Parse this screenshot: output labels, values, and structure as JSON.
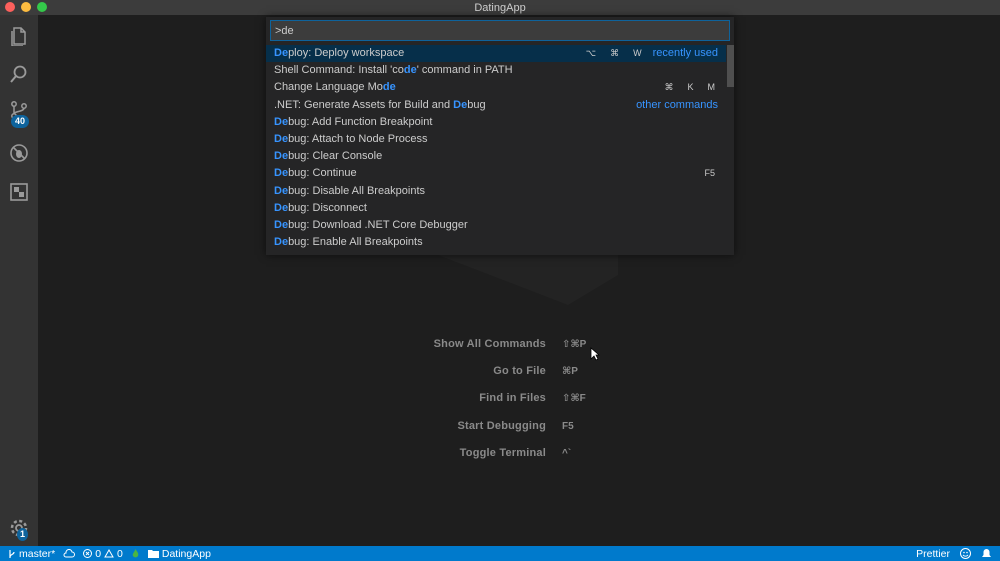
{
  "window": {
    "title": "DatingApp"
  },
  "activity": {
    "scm_badge": "40",
    "settings_badge": "1"
  },
  "palette": {
    "query": ">de",
    "items": [
      {
        "pre": "",
        "hl": "De",
        "post": "ploy: Deploy workspace",
        "keys": [
          "⌥",
          "⌘",
          "W"
        ],
        "tag": "recently used",
        "selected": true
      },
      {
        "pre": "Shell Command: Install 'co",
        "hl": "de",
        "post": "' command in PATH",
        "keys": [],
        "tag": ""
      },
      {
        "pre": "Change Language Mo",
        "hl": "de",
        "post": "",
        "keys": [
          "⌘",
          "K",
          "M"
        ],
        "tag": ""
      },
      {
        "pre": ".NET: Generate Assets for Build and ",
        "hl": "De",
        "post": "bug",
        "keys": [],
        "tag": "other commands"
      },
      {
        "pre": "",
        "hl": "De",
        "post": "bug: Add Function Breakpoint",
        "keys": [],
        "tag": ""
      },
      {
        "pre": "",
        "hl": "De",
        "post": "bug: Attach to Node Process",
        "keys": [],
        "tag": ""
      },
      {
        "pre": "",
        "hl": "De",
        "post": "bug: Clear Console",
        "keys": [],
        "tag": ""
      },
      {
        "pre": "",
        "hl": "De",
        "post": "bug: Continue",
        "keys": [
          "F5"
        ],
        "tag": ""
      },
      {
        "pre": "",
        "hl": "De",
        "post": "bug: Disable All Breakpoints",
        "keys": [],
        "tag": ""
      },
      {
        "pre": "",
        "hl": "De",
        "post": "bug: Disconnect",
        "keys": [],
        "tag": ""
      },
      {
        "pre": "",
        "hl": "De",
        "post": "bug: Download .NET Core Debugger",
        "keys": [],
        "tag": ""
      },
      {
        "pre": "",
        "hl": "De",
        "post": "bug: Enable All Breakpoints",
        "keys": [],
        "tag": ""
      }
    ]
  },
  "shortcuts": [
    {
      "label": "Show All Commands",
      "key": "⇧⌘P"
    },
    {
      "label": "Go to File",
      "key": "⌘P"
    },
    {
      "label": "Find in Files",
      "key": "⇧⌘F"
    },
    {
      "label": "Start Debugging",
      "key": "F5"
    },
    {
      "label": "Toggle Terminal",
      "key": "^`"
    }
  ],
  "status": {
    "branch": "master*",
    "errors": "0",
    "warnings": "0",
    "folder": "DatingApp",
    "prettier": "Prettier"
  },
  "colors": {
    "accent": "#007acc",
    "highlight": "#3794ff",
    "selection": "#062f4a"
  }
}
